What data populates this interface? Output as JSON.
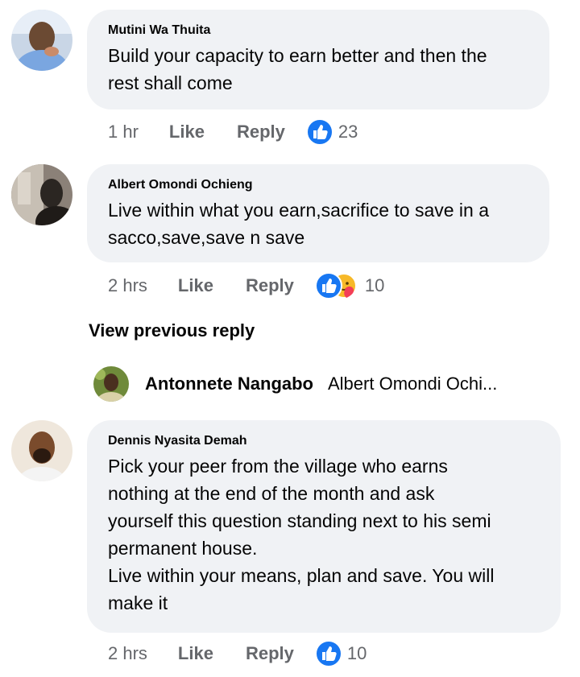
{
  "comments": [
    {
      "author": "Mutini Wa Thuita",
      "lines": [
        "Build your capacity to earn better and then the",
        "rest shall come"
      ],
      "time": "1 hr",
      "like_label": "Like",
      "reply_label": "Reply",
      "reaction_count": "23",
      "reactions": [
        "like-icon"
      ]
    },
    {
      "author": "Albert Omondi Ochieng",
      "lines": [
        "Live within what you earn,sacrifice to save in a",
        "sacco,save,save n save"
      ],
      "time": "2 hrs",
      "like_label": "Like",
      "reply_label": "Reply",
      "reaction_count": "10",
      "reactions": [
        "like-icon",
        "care-icon"
      ]
    },
    {
      "author": "Dennis Nyasita Demah",
      "lines": [
        "Pick your peer from the village who earns",
        "nothing at the end of the month and ask",
        "yourself this question standing next to his semi",
        "permanent house.",
        "Live within your means, plan and save. You will",
        "make it"
      ],
      "time": "2 hrs",
      "like_label": "Like",
      "reply_label": "Reply",
      "reaction_count": "10",
      "reactions": [
        "like-icon"
      ]
    }
  ],
  "view_previous_reply": "View previous reply",
  "reply_preview": {
    "author": "Antonnete Nangabo",
    "text": "Albert Omondi Ochi..."
  },
  "colors": {
    "bubble": "#f0f2f5",
    "text": "#050505",
    "secondary": "#65676b",
    "like_blue": "#1877f2",
    "care_yellow": "#f7b928"
  }
}
